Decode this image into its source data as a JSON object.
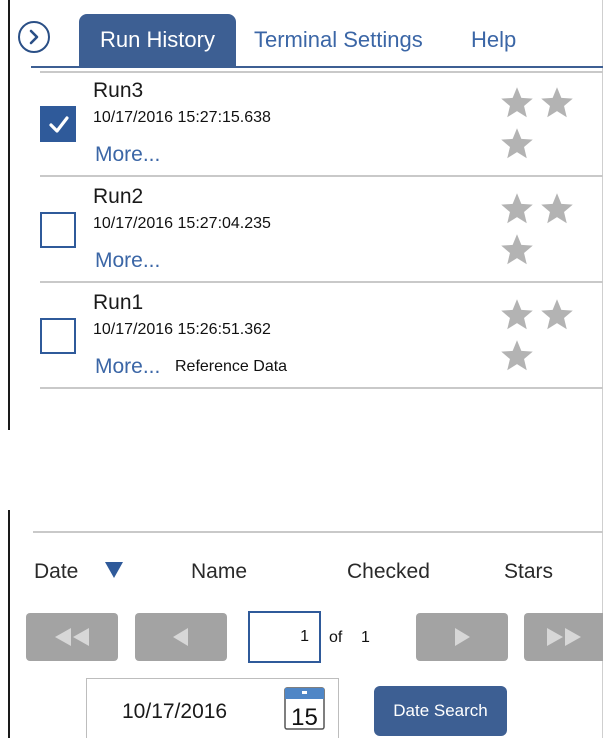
{
  "tabs": [
    {
      "label": "Run History",
      "active": true
    },
    {
      "label": "Terminal Settings",
      "active": false
    },
    {
      "label": "Help",
      "active": false
    }
  ],
  "runs": [
    {
      "name": "Run3",
      "timestamp": "10/17/2016 15:27:15.638",
      "more": "More...",
      "checked": true,
      "note": ""
    },
    {
      "name": "Run2",
      "timestamp": "10/17/2016 15:27:04.235",
      "more": "More...",
      "checked": false,
      "note": ""
    },
    {
      "name": "Run1",
      "timestamp": "10/17/2016 15:26:51.362",
      "more": "More...",
      "checked": false,
      "note": "Reference Data"
    }
  ],
  "columns": {
    "date": "Date",
    "name": "Name",
    "checked": "Checked",
    "stars": "Stars"
  },
  "sort": {
    "column": "Date",
    "direction": "descending"
  },
  "pagination": {
    "current": "1",
    "of_label": "of",
    "total": "1"
  },
  "date_filter": {
    "value": "10/17/2016",
    "calendar_day": "15",
    "search_label": "Date Search"
  },
  "colors": {
    "accent": "#3d5f93",
    "link": "#3b66a6",
    "disabled_button": "#a3a3a3",
    "star": "#b3b3b3"
  },
  "icons": {
    "collapse": "chevron-right-circle-icon",
    "star": "star-icon",
    "calendar": "calendar-icon",
    "checkbox": "check-icon"
  }
}
